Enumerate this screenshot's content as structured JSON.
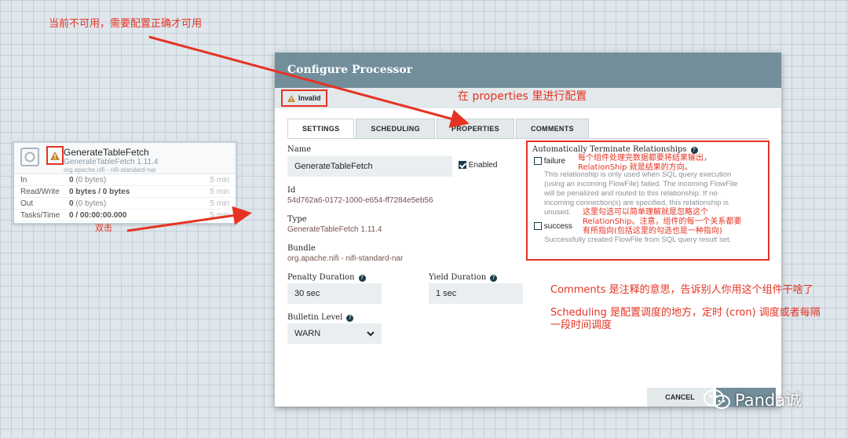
{
  "canvas": {
    "processor": {
      "name": "GenerateTableFetch",
      "type": "GenerateTableFetch 1.11.4",
      "bundle": "org.apache.nifi - nifi-standard-nar",
      "stats": [
        {
          "label": "In",
          "value": "0",
          "detail": "(0 bytes)",
          "time": "5 min"
        },
        {
          "label": "Read/Write",
          "value": "0 bytes / 0 bytes",
          "detail": "",
          "time": "5 min"
        },
        {
          "label": "Out",
          "value": "0",
          "detail": "(0 bytes)",
          "time": "5 min"
        },
        {
          "label": "Tasks/Time",
          "value": "0 / 00:00:00.000",
          "detail": "",
          "time": "5 min"
        }
      ]
    }
  },
  "dialog": {
    "title": "Configure Processor",
    "status": "Invalid",
    "tabs": [
      "SETTINGS",
      "SCHEDULING",
      "PROPERTIES",
      "COMMENTS"
    ],
    "active_tab": "SETTINGS",
    "settings": {
      "name_label": "Name",
      "name_value": "GenerateTableFetch",
      "enabled_label": "Enabled",
      "enabled": true,
      "id_label": "Id",
      "id_value": "54d762a6-0172-1000-e654-ff7284e5eb56",
      "type_label": "Type",
      "type_value": "GenerateTableFetch 1.11.4",
      "bundle_label": "Bundle",
      "bundle_value": "org.apache.nifi - nifi-standard-nar",
      "penalty_label": "Penalty Duration",
      "penalty_value": "30 sec",
      "yield_label": "Yield Duration",
      "yield_value": "1 sec",
      "bulletin_label": "Bulletin Level",
      "bulletin_value": "WARN"
    },
    "relationships": {
      "title": "Automatically Terminate Relationships",
      "items": [
        {
          "name": "failure",
          "checked": false,
          "desc_lines": [
            "This relationship is only used when SQL query execution",
            "(using an incoming FlowFile) failed. The incoming FlowFile",
            "will be penalized and routed to this relationship. If no",
            "incoming connection(s) are specified, this relationship is",
            "unused."
          ]
        },
        {
          "name": "success",
          "checked": false,
          "desc_lines": [
            "Successfully created FlowFile from SQL query result set."
          ]
        }
      ]
    },
    "buttons": {
      "cancel": "CANCEL",
      "apply": "APPLY"
    }
  },
  "annotations": {
    "top_note": "当前不可用，需要配置正确才可用",
    "double_click": "双击",
    "properties_note": "在 properties 里进行配置",
    "relationship_note": [
      "每个组件处理完数据都要将结果输出，",
      "RelationShip 就是结果的方向。"
    ],
    "checkbox_note": [
      "这里勾选可以简单理解就是忽略这个",
      "RelationShip。注意，组件的每一个关系都要",
      "有所指向(包括这里的勾选也是一种指向)"
    ],
    "comments_note": "Comments 是注释的意思，告诉别人你用这个组件干啥了",
    "scheduling_note": [
      "Scheduling 是配置调度的地方，定时 (cron) 调度或者每隔",
      "一段时间调度"
    ]
  },
  "watermark": "Panda诚",
  "colors": {
    "annotation": "#e53323",
    "header": "#728e9b",
    "value_text": "#775351",
    "accent_dark": "#1a3b4a"
  }
}
